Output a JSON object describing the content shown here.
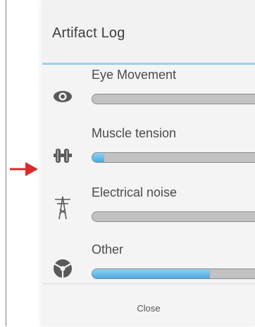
{
  "dialog": {
    "title": "Artifact Log",
    "accent_color": "#9fd0ec",
    "bar_fill_color": "#4aa9de",
    "bar_track_color": "#c2c2c2",
    "pointer_color": "#d92b2b",
    "items": [
      {
        "label": "Eye Movement",
        "icon": "eye-icon",
        "fill": 0.0
      },
      {
        "label": "Muscle tension",
        "icon": "muscle-icon",
        "fill": 0.07
      },
      {
        "label": "Electrical noise",
        "icon": "power-tower-icon",
        "fill": 0.0
      },
      {
        "label": "Other",
        "icon": "pie-segments-icon",
        "fill": 0.7
      }
    ],
    "close_label": "Close"
  }
}
